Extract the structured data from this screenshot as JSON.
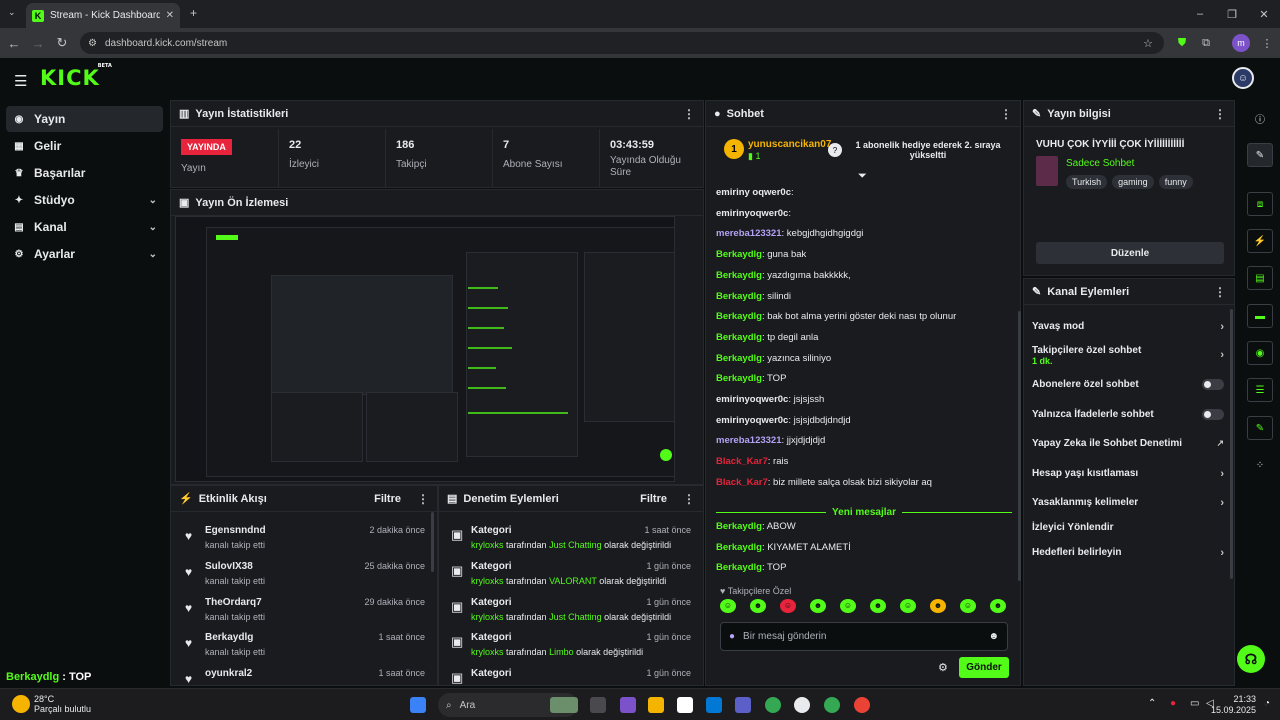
{
  "browser": {
    "tab_title": "Stream - Kick Dashboard",
    "url": "dashboard.kick.com/stream",
    "profile_initial": "m"
  },
  "header": {
    "logo": "KICK",
    "logo_badge": "BETA"
  },
  "sidebar": {
    "items": [
      {
        "label": "Yayın",
        "icon": "broadcast-icon",
        "active": true
      },
      {
        "label": "Gelir",
        "icon": "dollar-icon"
      },
      {
        "label": "Başarılar",
        "icon": "trophy-icon"
      },
      {
        "label": "Stüdyo",
        "icon": "studio-icon",
        "expandable": true
      },
      {
        "label": "Kanal",
        "icon": "channel-icon",
        "expandable": true
      },
      {
        "label": "Ayarlar",
        "icon": "gear-icon",
        "expandable": true
      }
    ]
  },
  "stats": {
    "title": "Yayın İstatistikleri",
    "live_badge": "YAYINDA",
    "live_label": "Yayın",
    "items": [
      {
        "value": "22",
        "label": "İzleyici"
      },
      {
        "value": "186",
        "label": "Takipçi"
      },
      {
        "value": "7",
        "label": "Abone Sayısı"
      },
      {
        "value": "03:43:59",
        "label": "Yayında Olduğu Süre"
      }
    ]
  },
  "preview": {
    "title": "Yayın Ön İzlemesi"
  },
  "activity": {
    "title": "Etkinlik Akışı",
    "filter": "Filtre",
    "rows": [
      {
        "name": "Egensnndnd",
        "sub": "kanalı takip etti",
        "time": "2 dakika önce"
      },
      {
        "name": "SulovIX38",
        "sub": "kanalı takip etti",
        "time": "25 dakika önce"
      },
      {
        "name": "TheOrdarq7",
        "sub": "kanalı takip etti",
        "time": "29 dakika önce"
      },
      {
        "name": "Berkaydlg",
        "sub": "kanalı takip etti",
        "time": "1 saat önce"
      },
      {
        "name": "oyunkral2",
        "sub": "",
        "time": "1 saat önce"
      }
    ]
  },
  "moderation": {
    "title": "Denetim Eylemleri",
    "filter": "Filtre",
    "rows": [
      {
        "name": "Kategori",
        "user": "kryloxks",
        "mid": " tarafından ",
        "cat": "Just Chatting",
        "end": " olarak değiştirildi",
        "time": "1 saat önce"
      },
      {
        "name": "Kategori",
        "user": "kryloxks",
        "mid": " tarafından ",
        "cat": "VALORANT",
        "end": " olarak değiştirildi",
        "time": "1 gün önce"
      },
      {
        "name": "Kategori",
        "user": "kryloxks",
        "mid": " tarafından ",
        "cat": "Just Chatting",
        "end": " olarak değiştirildi",
        "time": "1 gün önce"
      },
      {
        "name": "Kategori",
        "user": "kryloxks",
        "mid": " tarafından ",
        "cat": "Limbo",
        "end": " olarak değiştirildi",
        "time": "1 gün önce"
      },
      {
        "name": "Kategori",
        "user": "",
        "mid": "",
        "cat": "",
        "end": "",
        "time": "1 gün önce"
      }
    ]
  },
  "chat": {
    "title": "Sohbet",
    "pinned_user": "yunuscancikan07",
    "pinned_count": "1",
    "pinned_text": "1 abonelik hediye ederek 2. sıraya yükseltti",
    "messages": [
      {
        "user": "emiriny oqwer0c",
        "text": "",
        "color": "#e8eaed"
      },
      {
        "user": "emirinyoqwer0c",
        "text": "",
        "color": "#e8eaed"
      },
      {
        "user": "mereba123321",
        "text": "kebgjdhgidhgigdgi",
        "color": "#b5a3f5"
      },
      {
        "user": "Berkaydlg",
        "text": "guna bak",
        "color": "#53fc18"
      },
      {
        "user": "Berkaydlg",
        "text": "yazdıgıma bakkkkk,",
        "color": "#53fc18"
      },
      {
        "user": "Berkaydlg",
        "text": "silindi",
        "color": "#53fc18"
      },
      {
        "user": "Berkaydlg",
        "text": "bak bot alma yerini göster deki nası tp olunur",
        "color": "#53fc18"
      },
      {
        "user": "Berkaydlg",
        "text": "tp degil anla",
        "color": "#53fc18"
      },
      {
        "user": "Berkaydlg",
        "text": "yazınca siliniyo",
        "color": "#53fc18"
      },
      {
        "user": "Berkaydlg",
        "text": "TOP",
        "color": "#53fc18"
      },
      {
        "user": "emirinyoqwer0c",
        "text": "jsjsjssh",
        "color": "#e8eaed"
      },
      {
        "user": "emirinyoqwer0c",
        "text": "jsjsjdbdjdndjd",
        "color": "#e8eaed"
      },
      {
        "user": "mereba123321",
        "text": "jjxjdjdjdjd",
        "color": "#b5a3f5"
      },
      {
        "user": "Black_Kar7",
        "text": "rais",
        "color": "#e8233c"
      },
      {
        "user": "Black_Kar7",
        "text": "biz millete salça olsak bizi sikiyolar aq",
        "color": "#e8233c"
      }
    ],
    "new_messages_label": "Yeni mesajlar",
    "new_messages": [
      {
        "user": "Berkaydlg",
        "text": "ABOW",
        "color": "#53fc18"
      },
      {
        "user": "Berkaydlg",
        "text": "KIYAMET ALAMETİ",
        "color": "#53fc18"
      },
      {
        "user": "Berkaydlg",
        "text": "TOP",
        "color": "#53fc18"
      }
    ],
    "follower_label": "Takipçilere Özel",
    "input_placeholder": "Bir mesaj gönderin",
    "send_label": "Gönder"
  },
  "stream_info": {
    "title": "Yayın bilgisi",
    "stream_title": "VUHU ÇOK İYYİİİ ÇOK İYİİİİİİİİİİİ",
    "category": "Sadece Sohbet",
    "tags": [
      "Turkish",
      "gaming",
      "funny"
    ],
    "edit_label": "Düzenle"
  },
  "channel_actions": {
    "title": "Kanal Eylemleri",
    "items": [
      {
        "label": "Yavaş mod",
        "control": "arrow"
      },
      {
        "label": "Takipçilere özel sohbet",
        "sub": "1 dk.",
        "control": "arrow"
      },
      {
        "label": "Abonelere özel sohbet",
        "control": "toggle"
      },
      {
        "label": "Yalnızca İfadelerle sohbet",
        "control": "toggle"
      },
      {
        "label": "Yapay Zeka ile Sohbet Denetimi",
        "control": "external"
      },
      {
        "label": "Hesap yaşı kısıtlaması",
        "control": "arrow"
      },
      {
        "label": "Yasaklanmış kelimeler",
        "control": "arrow"
      },
      {
        "label": "İzleyici Yönlendir",
        "control": "none"
      },
      {
        "label": "Hedefleri belirleyin",
        "control": "arrow"
      }
    ]
  },
  "overlay_chat": {
    "user": "Berkaydlg",
    "text": "TOP"
  },
  "taskbar": {
    "temp": "28°C",
    "weather": "Parçalı bulutlu",
    "search": "Ara",
    "time": "21:33",
    "date": "15.09.2025"
  }
}
